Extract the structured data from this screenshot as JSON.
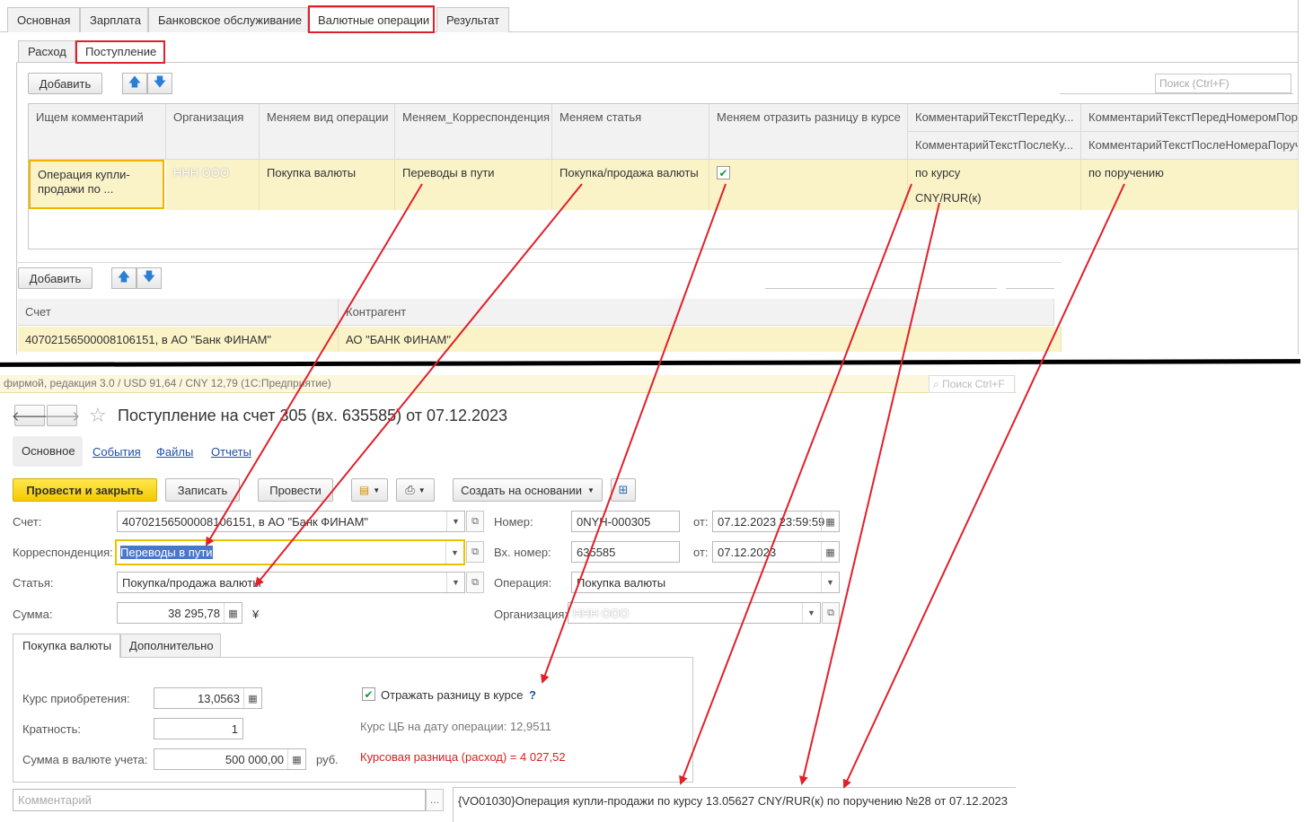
{
  "top_tabs": [
    "Основная",
    "Зарплата",
    "Банковское обслуживание",
    "Валютные операции",
    "Результат"
  ],
  "sub_tabs": [
    "Расход",
    "Поступление"
  ],
  "toolbar": {
    "add_label": "Добавить",
    "search_placeholder": "Поиск (Ctrl+F)"
  },
  "grid1": {
    "headers": [
      "Ищем комментарий",
      "Организация",
      "Меняем вид операции",
      "Меняем_Корреспонденция",
      "Меняем статья",
      "Меняем отразить разницу в курсе",
      "КомментарийТекстПередКу...",
      "КомментарийТекстПередНомеромПоруч..."
    ],
    "headers2": [
      "КомментарийТекстПослеКу...",
      "КомментарийТекстПослеНомераПоруч..."
    ],
    "row": [
      "Операция купли-продажи по ...",
      "ННН ООО",
      "Покупка валюты",
      "Переводы в пути",
      "Покупка/продажа валюты",
      "✔",
      "по курсу",
      "по поручению"
    ],
    "row2": [
      "CNY/RUR(к)",
      ""
    ]
  },
  "grid2": {
    "add_label": "Добавить",
    "headers": [
      "Счет",
      "Контрагент"
    ],
    "row": [
      "40702156500008106151, в АО \"Банк ФИНАМ\"",
      "АО \"БАНК ФИНАМ\""
    ]
  },
  "doc": {
    "window_title": "фирмой, редакция 3.0 / USD 91,64 / CNY 12,79 (1С:Предприятие)",
    "search_placeholder": "Поиск Ctrl+F",
    "title": "Поступление на счет 305 (вх. 635585) от 07.12.2023",
    "nav": [
      "Основное",
      "События",
      "Файлы",
      "Отчеты"
    ],
    "buttons": {
      "post_close": "Провести и закрыть",
      "save": "Записать",
      "post": "Провести",
      "create_based": "Создать на основании"
    },
    "fields": {
      "account_label": "Счет:",
      "account_value": "40702156500008106151, в АО \"Банк ФИНАМ\"",
      "corr_label": "Корреспонденция:",
      "corr_value": "Переводы в пути",
      "article_label": "Статья:",
      "article_value": "Покупка/продажа валюты",
      "sum_label": "Сумма:",
      "sum_value": "38 295,78",
      "sum_currency": "¥",
      "number_label": "Номер:",
      "number_value": "0NYH-000305",
      "from_label": "от:",
      "date_value": "07.12.2023 23:59:59",
      "in_number_label": "Вх. номер:",
      "in_number_value": "635585",
      "in_date_value": "07.12.2023",
      "operation_label": "Операция:",
      "operation_value": "Покупка валюты",
      "org_label": "Организация:",
      "org_value": "ННН ООО"
    },
    "inner_tabs": [
      "Покупка валюты",
      "Дополнительно"
    ],
    "purchase": {
      "rate_label": "Курс приобретения:",
      "rate_value": "13,0563",
      "mult_label": "Кратность:",
      "mult_value": "1",
      "sum_label": "Сумма в валюте учета:",
      "sum_value": "500 000,00",
      "sum_unit": "руб.",
      "reflect_label": "Отражать разницу в курсе",
      "help": "?",
      "cb_rate": "Курс ЦБ на дату операции: 12,9511",
      "diff": "Курсовая разница (расход) = 4 027,52"
    },
    "comment_placeholder": "Комментарий",
    "payment_purpose": "{VO01030}Операция купли-продажи по курсу 13.05627 CNY/RUR(к) по поручению №28 от 07.12.2023"
  },
  "colors": {
    "highlight_row": "#fbf3c8",
    "accent_red": "#e0202a",
    "yellow_button": "#f5c900",
    "link": "#1e4fa8"
  }
}
